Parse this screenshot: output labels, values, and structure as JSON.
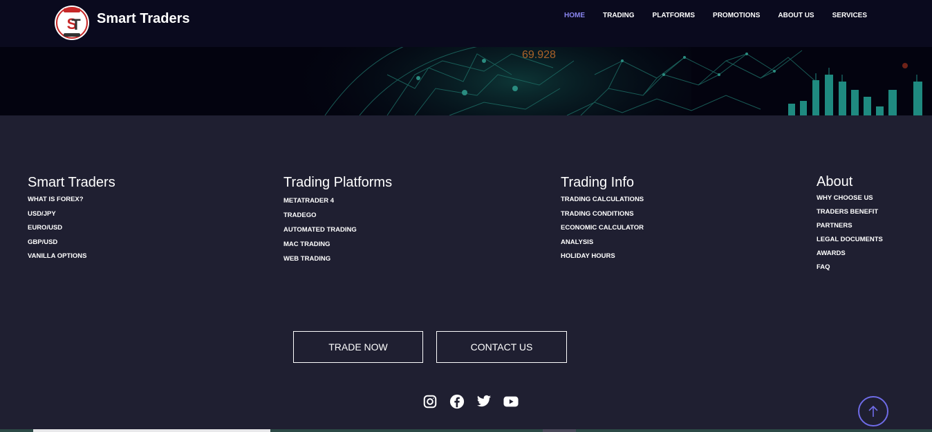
{
  "header": {
    "brand": "Smart Traders",
    "nav": [
      {
        "label": "HOME",
        "active": true
      },
      {
        "label": "TRADING"
      },
      {
        "label": "PLATFORMS"
      },
      {
        "label": "PROMOTIONS"
      },
      {
        "label": "ABOUT US"
      },
      {
        "label": "SERVICES"
      }
    ]
  },
  "hero": {
    "ticker_value": "69.928"
  },
  "footer": {
    "columns": [
      {
        "title": "Smart Traders",
        "links": [
          "WHAT IS FOREX?",
          "USD/JPY",
          "EURO/USD",
          "GBP/USD",
          "VANILLA OPTIONS"
        ]
      },
      {
        "title": "Trading Platforms",
        "links": [
          "METATRADER 4",
          "TRADEGO",
          "AUTOMATED TRADING",
          "MAC TRADING",
          "WEB TRADING"
        ]
      },
      {
        "title": "Trading Info",
        "links": [
          "TRADING CALCULATIONS",
          "TRADING CONDITIONS",
          "ECONOMIC CALCULATOR",
          "ANALYSIS",
          "HOLIDAY HOURS"
        ]
      },
      {
        "title": "About",
        "links": [
          "WHY CHOOSE US",
          "TRADERS BENEFIT",
          "PARTNERS",
          "LEGAL DOCUMENTS",
          "AWARDS",
          "FAQ"
        ]
      }
    ],
    "buttons": {
      "trade": "TRADE NOW",
      "contact": "CONTACT US"
    },
    "social": [
      "instagram-icon",
      "facebook-icon",
      "twitter-icon",
      "youtube-icon"
    ]
  },
  "colors": {
    "header_bg": "#0a0a1e",
    "footer_bg": "#1f1f31",
    "accent": "#8a86f0",
    "logo_red": "#d32f2f"
  }
}
